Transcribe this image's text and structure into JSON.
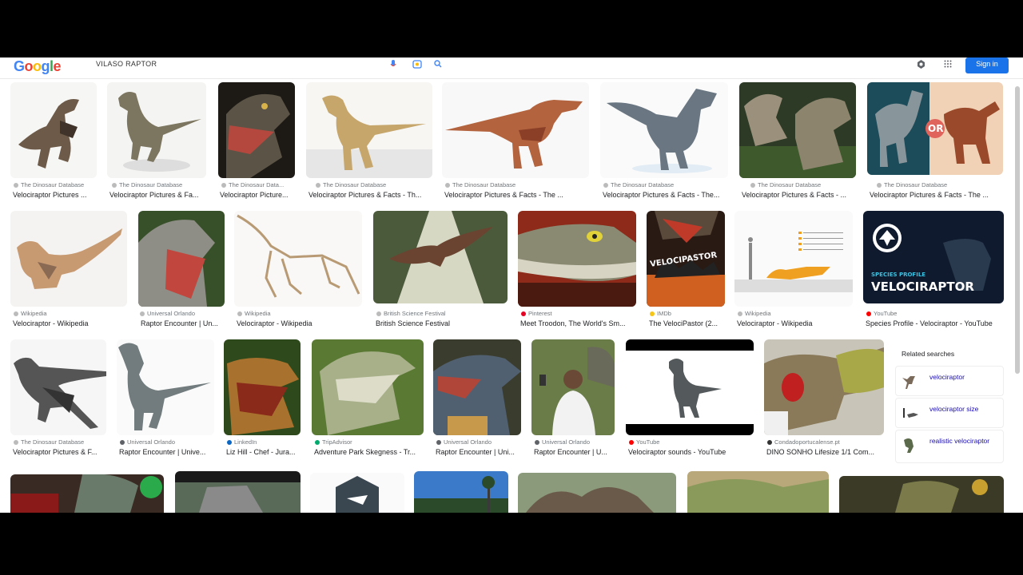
{
  "header": {
    "logo": "Google",
    "query": "VILASO RAPTOR",
    "sign_in": "Sign in",
    "icons": [
      "mic-icon",
      "camera-icon",
      "search-icon",
      "settings-icon",
      "apps-icon"
    ]
  },
  "rows": [
    [
      {
        "source": "The Dinosaur Database",
        "title": "Velociraptor Pictures ..."
      },
      {
        "source": "The Dinosaur Database",
        "title": "Velociraptor Pictures & Fa..."
      },
      {
        "source": "The Dinosaur Data...",
        "title": "Velociraptor Picture..."
      },
      {
        "source": "The Dinosaur Database",
        "title": "Velociraptor Pictures & Facts - Th..."
      },
      {
        "source": "The Dinosaur Database",
        "title": "Velociraptor Pictures & Facts - The ..."
      },
      {
        "source": "The Dinosaur Database",
        "title": "Velociraptor Pictures & Facts - The..."
      },
      {
        "source": "The Dinosaur Database",
        "title": "Velociraptor Pictures & Facts - ..."
      },
      {
        "source": "The Dinosaur Database",
        "title": "Velociraptor Pictures & Facts - The ..."
      }
    ],
    [
      {
        "source": "Wikipedia",
        "title": "Velociraptor - Wikipedia"
      },
      {
        "source": "Universal Orlando",
        "title": "Raptor Encounter | Un..."
      },
      {
        "source": "Wikipedia",
        "title": "Velociraptor - Wikipedia"
      },
      {
        "source": "British Science Festival",
        "title": "British Science Festival"
      },
      {
        "source": "Pinterest",
        "title": "Meet Troodon, The World's Sm..."
      },
      {
        "source": "IMDb",
        "title": "The VelociPastor (2..."
      },
      {
        "source": "Wikipedia",
        "title": "Velociraptor - Wikipedia"
      },
      {
        "source": "YouTube",
        "title": "Species Profile - Velociraptor - YouTube"
      }
    ],
    [
      {
        "source": "The Dinosaur Database",
        "title": "Velociraptor Pictures & F..."
      },
      {
        "source": "Universal Orlando",
        "title": "Raptor Encounter | Unive..."
      },
      {
        "source": "LinkedIn",
        "title": "Liz Hill - Chef - Jura..."
      },
      {
        "source": "TripAdvisor",
        "title": "Adventure Park Skegness - Tr..."
      },
      {
        "source": "Universal Orlando",
        "title": "Raptor Encounter | Uni..."
      },
      {
        "source": "Universal Orlando",
        "title": "Raptor Encounter | U..."
      },
      {
        "source": "YouTube",
        "title": "Velociraptor sounds - YouTube"
      },
      {
        "source": "Condadoportucalense.pt",
        "title": "DINO SONHO Lifesize 1/1 Com..."
      }
    ]
  ],
  "image_text": {
    "or_badge": "OR",
    "species_profile": "SPECIES PROFILE",
    "velociraptor": "VELOCIRAPTOR",
    "velocipastor": "VELOCIPASTOR"
  },
  "related": {
    "heading": "Related searches",
    "items": [
      "velociraptor",
      "velociraptor size",
      "realistic velociraptor"
    ]
  },
  "colors": {
    "accent": "#1a73e8",
    "link": "#1a0dab",
    "source_gray": "#70757a",
    "youtube": "#ff0000"
  }
}
